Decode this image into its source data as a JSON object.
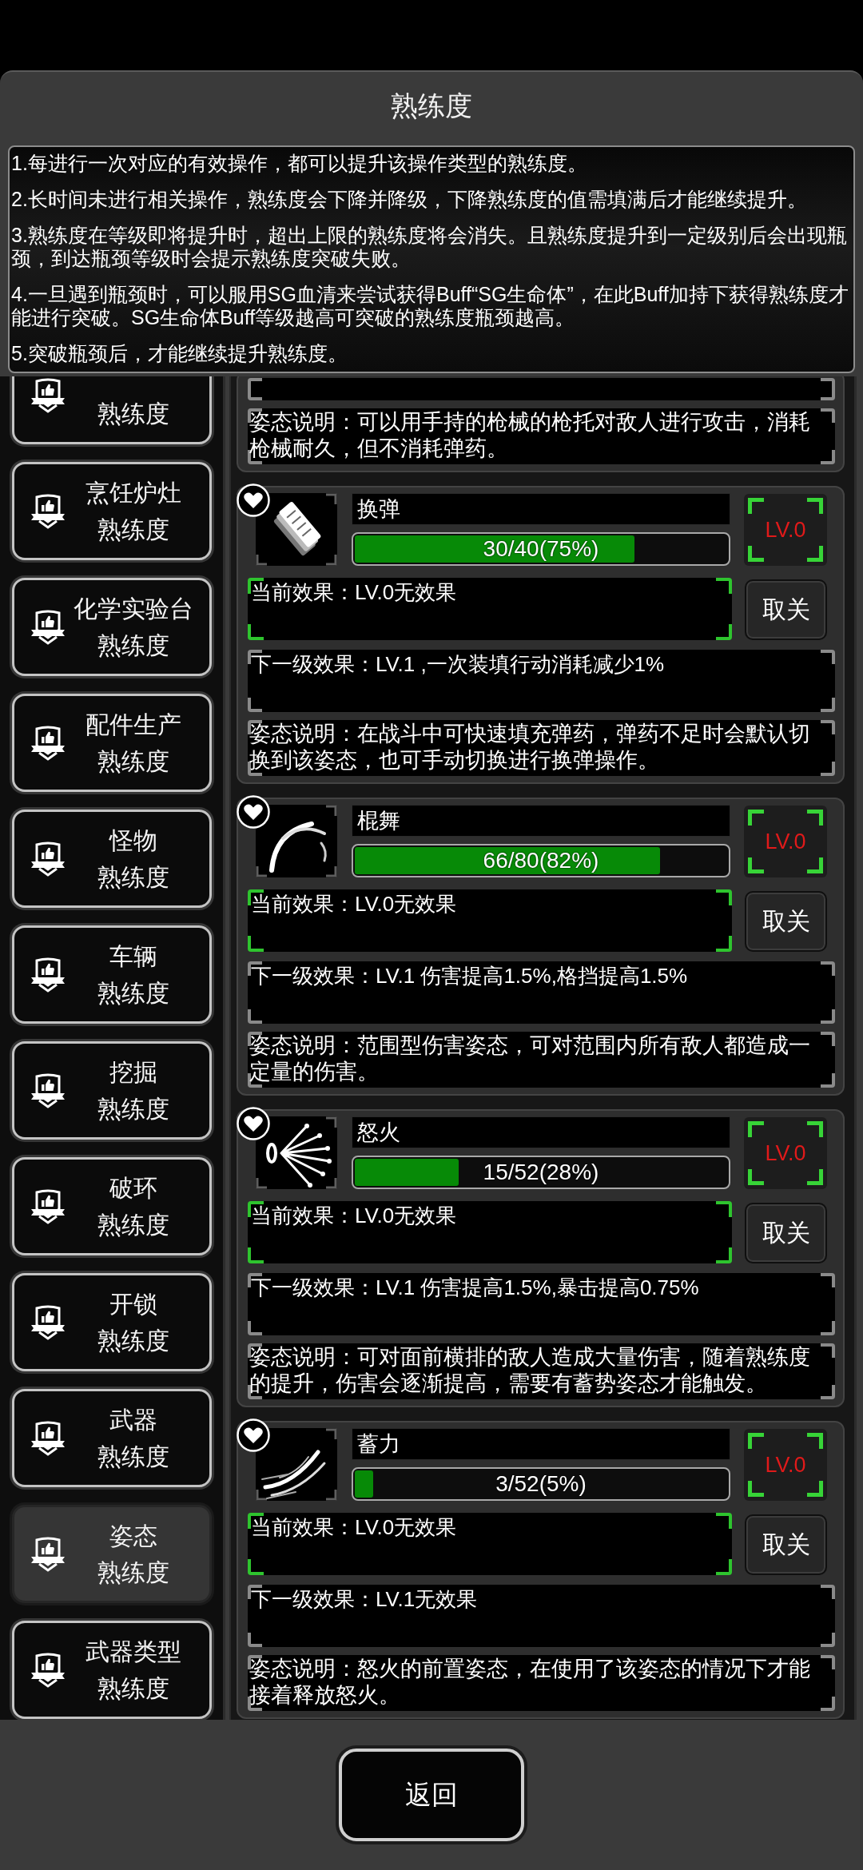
{
  "window": {
    "title": "熟练度"
  },
  "rules": [
    "1.每进行一次对应的有效操作，都可以提升该操作类型的熟练度。",
    "2.长时间未进行相关操作，熟练度会下降并降级，下降熟练度的值需填满后才能继续提升。",
    "3.熟练度在等级即将提升时，超出上限的熟练度将会消失。且熟练度提升到一定级别后会出现瓶颈，到达瓶颈等级时会提示熟练度突破失败。",
    "4.一旦遇到瓶颈时，可以服用SG血清来尝试获得Buff“SG生命体”，在此Buff加持下获得熟练度才能进行突破。SG生命体Buff等级越高可突破的熟练度瓶颈越高。",
    "5.突破瓶颈后，才能继续提升熟练度。"
  ],
  "sidebar": {
    "items": [
      {
        "lines": [
          "熟练度"
        ],
        "selected": false
      },
      {
        "lines": [
          "烹饪炉灶",
          "熟练度"
        ],
        "selected": false
      },
      {
        "lines": [
          "化学实验台",
          "熟练度"
        ],
        "selected": false
      },
      {
        "lines": [
          "配件生产",
          "熟练度"
        ],
        "selected": false
      },
      {
        "lines": [
          "怪物",
          "熟练度"
        ],
        "selected": false
      },
      {
        "lines": [
          "车辆",
          "熟练度"
        ],
        "selected": false
      },
      {
        "lines": [
          "挖掘",
          "熟练度"
        ],
        "selected": false
      },
      {
        "lines": [
          "破环",
          "熟练度"
        ],
        "selected": false
      },
      {
        "lines": [
          "开锁",
          "熟练度"
        ],
        "selected": false
      },
      {
        "lines": [
          "武器",
          "熟练度"
        ],
        "selected": false
      },
      {
        "lines": [
          "姿态",
          "熟练度"
        ],
        "selected": true
      },
      {
        "lines": [
          "武器类型",
          "熟练度"
        ],
        "selected": false
      }
    ]
  },
  "skills": [
    {
      "description": "姿态说明：可以用手持的枪械的枪托对敌人进行攻击，消耗枪械耐久，但不消耗弹药。"
    },
    {
      "name": "换弹",
      "level": 0.75,
      "reading": "30/40(75%)",
      "level_label": "LV.0",
      "current": "当前效果：LV.0无效果",
      "action": "取关",
      "next": "下一级效果：LV.1 ,一次装填行动消耗减少1%",
      "description": "姿态说明：在战斗中可快速填充弹药，弹药不足时会默认切换到该姿态，也可手动切换进行换弹操作。"
    },
    {
      "name": "棍舞",
      "level": 0.82,
      "reading": "66/80(82%)",
      "level_label": "LV.0",
      "current": "当前效果：LV.0无效果",
      "action": "取关",
      "next": "下一级效果：LV.1 伤害提高1.5%,格挡提高1.5%",
      "description": "姿态说明：范围型伤害姿态，可对范围内所有敌人都造成一定量的伤害。"
    },
    {
      "name": "怒火",
      "level": 0.28,
      "reading": "15/52(28%)",
      "level_label": "LV.0",
      "current": "当前效果：LV.0无效果",
      "action": "取关",
      "next": "下一级效果：LV.1 伤害提高1.5%,暴击提高0.75%",
      "description": "姿态说明：可对面前横排的敌人造成大量伤害，随着熟练度的提升，伤害会逐渐提高，需要有蓄势姿态才能触发。"
    },
    {
      "name": "蓄力",
      "level": 0.05,
      "reading": "3/52(5%)",
      "level_label": "LV.0",
      "current": "当前效果：LV.0无效果",
      "action": "取关",
      "next": "下一级效果：LV.1无效果",
      "description": "姿态说明：怒火的前置姿态，在使用了该姿态的情况下才能接着释放怒火。"
    }
  ],
  "footer": {
    "back_button": "返回"
  }
}
